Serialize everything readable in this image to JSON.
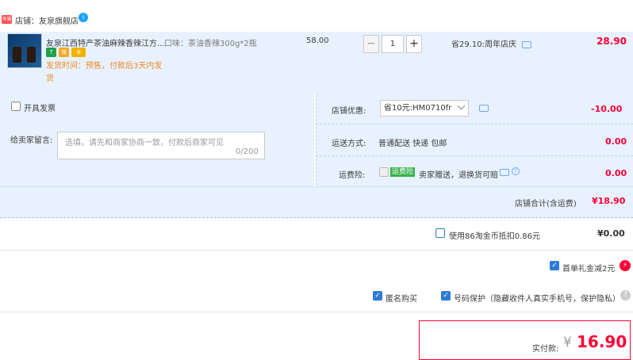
{
  "shop": {
    "badge": "天猫",
    "label": "店铺：友泉旗舰店",
    "ww": "i"
  },
  "item": {
    "title": "友泉江西特产茶油麻辣香辣江方...",
    "sku": "口味：茶油香辣300g*2瓶",
    "price": "58.00",
    "qty": "1",
    "ship_note": "发货时间：预售，付款后3天内发货",
    "saving": "省29.10:周年店庆",
    "subtotal": "28.90",
    "badges": [
      "7",
      "保",
      "卡"
    ]
  },
  "invoice": {
    "label": "开具发票"
  },
  "message": {
    "label": "给卖家留言:",
    "placeholder": "选填，请先和商家协商一致，付款后商家可见",
    "count": "0/200"
  },
  "coupon": {
    "label": "店铺优惠:",
    "selected": "省10元:HM0710fr",
    "amount": "-10.00"
  },
  "shipping": {
    "label": "运送方式:",
    "value": "普通配送 快递 包邮",
    "amount": "0.00"
  },
  "insurance": {
    "label": "运费险:",
    "tag": "运费险",
    "value": "卖家赠送，退换货可赔",
    "amount": "0.00"
  },
  "store_total": {
    "label": "店铺合计(含运费)",
    "value": "¥18.90"
  },
  "taojinbi": {
    "label": "使用86淘金币抵扣0.86元",
    "value": "¥0.00"
  },
  "first_order": {
    "label": "首单礼金减2元",
    "icon": "⚡"
  },
  "anonymous": {
    "label": "匿名购买"
  },
  "privacy": {
    "label": "号码保护（隐藏收件人真实手机号，保护隐私）",
    "help": "?"
  },
  "final": {
    "label": "实付款:",
    "currency": "¥",
    "value": "16.90"
  },
  "colors": {
    "accent": "#ff0036",
    "panel": "#e8f2ff",
    "check": "#2f7bd6",
    "orange": "#f08a24"
  }
}
